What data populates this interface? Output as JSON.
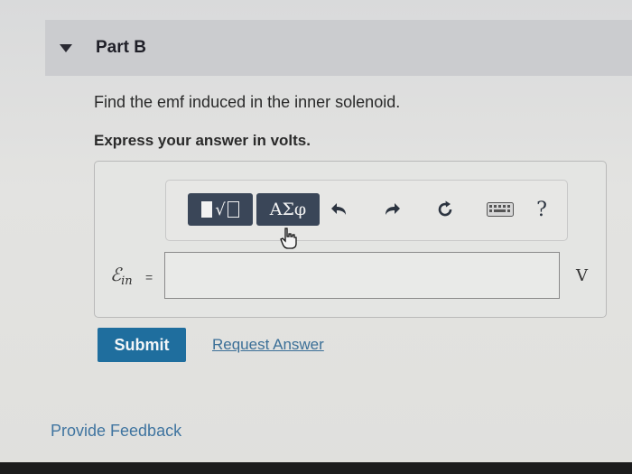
{
  "part": {
    "title": "Part B"
  },
  "question": {
    "prompt": "Find the emf induced in the inner solenoid.",
    "instruction": "Express your answer in volts."
  },
  "toolbar": {
    "symbols_label": "ΑΣφ",
    "help_label": "?",
    "icons": [
      "templates-icon",
      "symbols-icon",
      "undo-icon",
      "redo-icon",
      "reset-icon",
      "keyboard-icon",
      "help-icon"
    ]
  },
  "answer": {
    "variable": "ℰ",
    "subscript": "in",
    "equals": "=",
    "value": "",
    "unit": "V"
  },
  "actions": {
    "submit_label": "Submit",
    "request_label": "Request Answer"
  },
  "footer": {
    "feedback_label": "Provide Feedback"
  },
  "colors": {
    "header_bg": "#cbcccf",
    "toolbar_button": "#3a4658",
    "submit_bg": "#1f6e9e",
    "link": "#3b6f97"
  }
}
